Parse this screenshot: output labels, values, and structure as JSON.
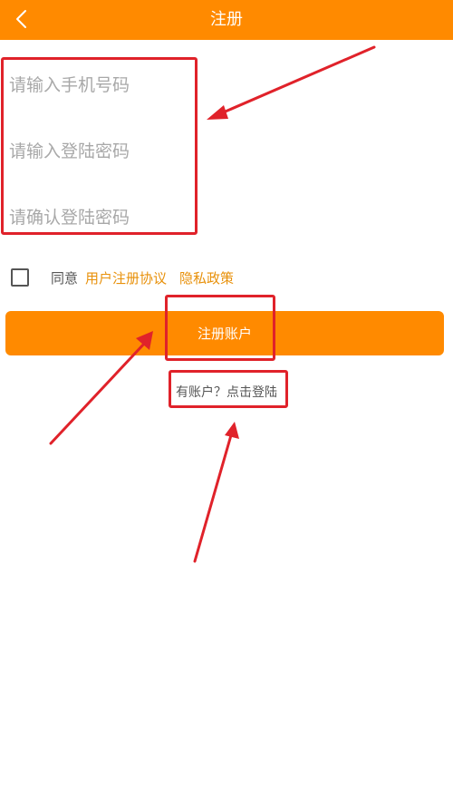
{
  "header": {
    "title": "注册",
    "back_icon": "chevron-left-icon",
    "background_color": "#FF8A00"
  },
  "form": {
    "phone_placeholder": "请输入手机号码",
    "password_placeholder": "请输入登陆密码",
    "confirm_placeholder": "请确认登陆密码"
  },
  "agreement": {
    "checked": false,
    "agree_label": "同意",
    "user_agreement_link": "用户注册协议",
    "privacy_link": "隐私政策",
    "link_color": "#E8910B"
  },
  "submit_button": {
    "label": "注册账户",
    "background_color": "#FF8A00"
  },
  "login_link": {
    "label": "有账户？点击登陆"
  },
  "annotations": {
    "highlight_color": "#E0222A"
  }
}
